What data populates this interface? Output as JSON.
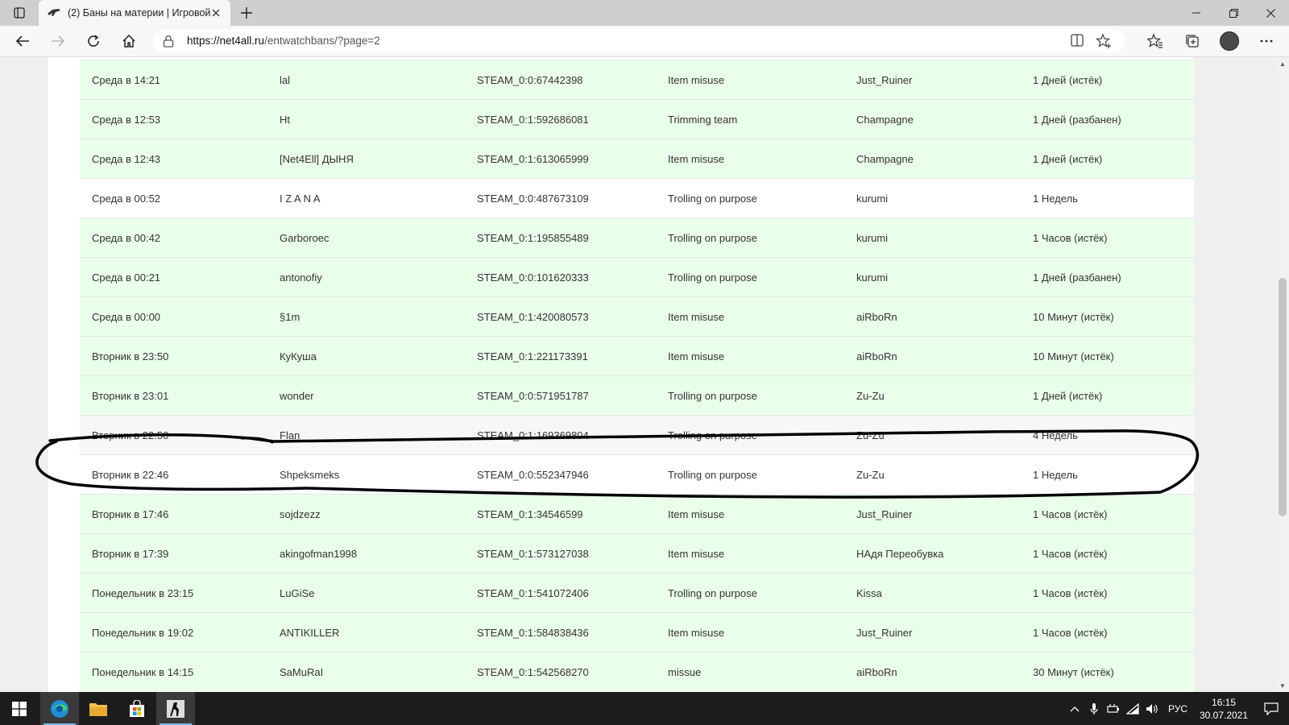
{
  "browser": {
    "tab_title": "(2) Баны на материи | Игровой",
    "url_host": "https://net4all.ru",
    "url_path": "/entwatchbans/?page=2"
  },
  "bans_table": {
    "rows": [
      {
        "date": "Среда в 14:21",
        "player": "lal",
        "steam_id": "STEAM_0:0:67442398",
        "reason": "Item misuse",
        "admin": "Just_Ruiner",
        "duration": "1 Дней (истёк)"
      },
      {
        "date": "Среда в 12:53",
        "player": "Ht",
        "steam_id": "STEAM_0:1:592686081",
        "reason": "Trimming team",
        "admin": "Champagne",
        "duration": "1 Дней (разбанен)"
      },
      {
        "date": "Среда в 12:43",
        "player": "[Net4Ell] ДЫНЯ",
        "steam_id": "STEAM_0:1:613065999",
        "reason": "Item misuse",
        "admin": "Champagne",
        "duration": "1 Дней (истёк)"
      },
      {
        "date": "Среда в 00:52",
        "player": "I Z A N A",
        "steam_id": "STEAM_0:0:487673109",
        "reason": "Trolling on purpose",
        "admin": "kurumi",
        "duration": "1 Недель"
      },
      {
        "date": "Среда в 00:42",
        "player": "Garboroec",
        "steam_id": "STEAM_0:1:195855489",
        "reason": "Trolling on purpose",
        "admin": "kurumi",
        "duration": "1 Часов (истёк)"
      },
      {
        "date": "Среда в 00:21",
        "player": "antonofiy",
        "steam_id": "STEAM_0:0:101620333",
        "reason": "Trolling on purpose",
        "admin": "kurumi",
        "duration": "1 Дней (разбанен)"
      },
      {
        "date": "Среда в 00:00",
        "player": "§1m",
        "steam_id": "STEAM_0:1:420080573",
        "reason": "Item misuse",
        "admin": "aiRboRn",
        "duration": "10 Минут (истёк)"
      },
      {
        "date": "Вторник в 23:50",
        "player": "КуКуша",
        "steam_id": "STEAM_0:1:221173391",
        "reason": "Item misuse",
        "admin": "aiRboRn",
        "duration": "10 Минут (истёк)"
      },
      {
        "date": "Вторник в 23:01",
        "player": "wonder",
        "steam_id": "STEAM_0:0:571951787",
        "reason": "Trolling on purpose",
        "admin": "Zu-Zu",
        "duration": "1 Дней (истёк)"
      },
      {
        "date": "Вторник в 22:50",
        "player": "Flan",
        "steam_id": "STEAM_0:1:169369804",
        "reason": "Trolling on purpose",
        "admin": "Zu-Zu",
        "duration": "4 Недель"
      },
      {
        "date": "Вторник в 22:46",
        "player": "Shpeksmeks",
        "steam_id": "STEAM_0:0:552347946",
        "reason": "Trolling on purpose",
        "admin": "Zu-Zu",
        "duration": "1 Недель"
      },
      {
        "date": "Вторник в 17:46",
        "player": "sojdzezz",
        "steam_id": "STEAM_0:1:34546599",
        "reason": "Item misuse",
        "admin": "Just_Ruiner",
        "duration": "1 Часов (истёк)"
      },
      {
        "date": "Вторник в 17:39",
        "player": "akingofman1998",
        "steam_id": "STEAM_0:1:573127038",
        "reason": "Item misuse",
        "admin": "НАдя Переобувка",
        "duration": "1 Часов (истёк)"
      },
      {
        "date": "Понедельник в 23:15",
        "player": "LuGiSe",
        "steam_id": "STEAM_0:1:541072406",
        "reason": "Trolling on purpose",
        "admin": "Kissa",
        "duration": "1 Часов (истёк)"
      },
      {
        "date": "Понедельник в 19:02",
        "player": "ANTIKILLER",
        "steam_id": "STEAM_0:1:584838436",
        "reason": "Item misuse",
        "admin": "Just_Ruiner",
        "duration": "1 Часов (истёк)"
      },
      {
        "date": "Понедельник в 14:15",
        "player": "SaMuRaI",
        "steam_id": "STEAM_0:1:542568270",
        "reason": "missue",
        "admin": "aiRboRn",
        "duration": "30 Минут (истёк)"
      }
    ]
  },
  "taskbar": {
    "language": "РУС",
    "time": "16:15",
    "date": "30.07.2021"
  },
  "colors": {
    "expired_row_bg": "#eaffea",
    "active_row_bg": "#ffffff",
    "scribble": "#000000"
  }
}
